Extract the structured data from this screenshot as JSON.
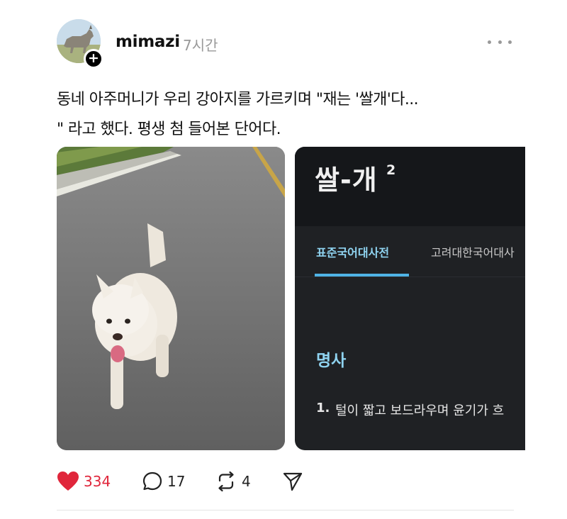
{
  "post": {
    "username": "mimazi",
    "timestamp": "7시간",
    "caption_lines": [
      "동네 아주머니가 우리 강아지를 가르키며 \"재는 '쌀개'다...",
      "\" 라고 했다. 평생 첨 들어본 단어다."
    ],
    "follow_badge": "+"
  },
  "dictionary_card": {
    "word": "쌀-개",
    "superscript": "2",
    "tabs": [
      "표준국어대사전",
      "고려대한국어대사"
    ],
    "active_tab_index": 0,
    "part_of_speech": "명사",
    "definition_number": "1.",
    "definition_text": "털이 짧고 보드라우며 윤기가 흐"
  },
  "actions": {
    "like_count": "334",
    "comment_count": "17",
    "repost_count": "4",
    "liked": true
  },
  "icons": {
    "like": "heart-icon",
    "comment": "comment-bubble-icon",
    "repost": "repost-icon",
    "share": "send-icon",
    "more": "more-dots-icon"
  },
  "colors": {
    "like_red": "#e0263b",
    "dict_accent": "#8fd3f0",
    "dict_bg": "#1f2124",
    "muted_gray": "#999999"
  }
}
